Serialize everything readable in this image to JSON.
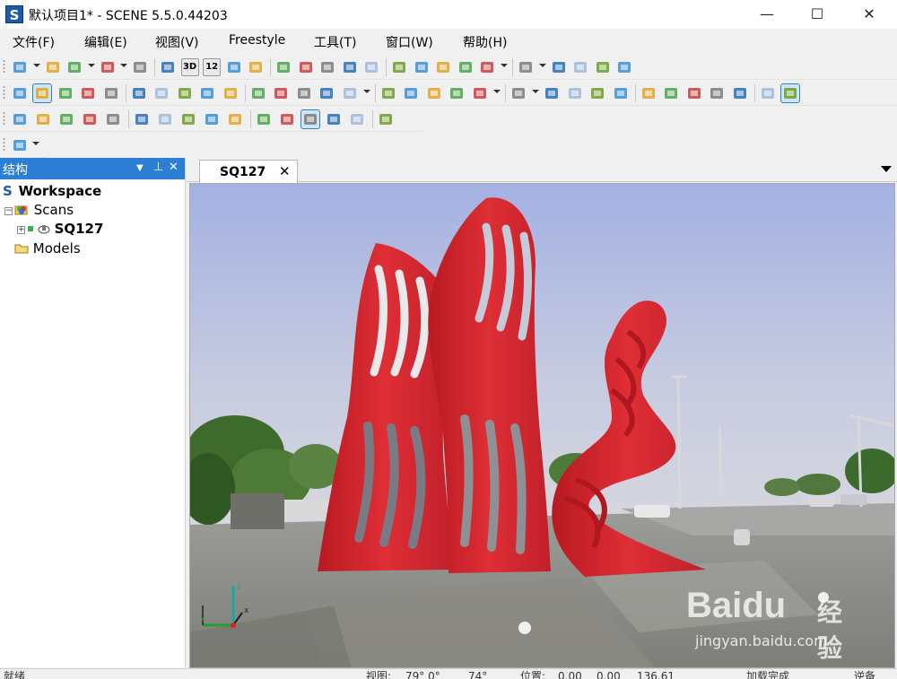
{
  "window": {
    "title": "默认项目1* - SCENE 5.5.0.44203",
    "icon_letter": "S",
    "controls": {
      "minimize": "—",
      "maximize": "☐",
      "close": "✕"
    }
  },
  "menu": {
    "items": [
      "文件(F)",
      "编辑(E)",
      "视图(V)",
      "Freestyle",
      "工具(T)",
      "窗口(W)",
      "帮助(H)"
    ]
  },
  "toolbar": {
    "row1": [
      {
        "icon": "new-project-icon",
        "dropdown": true
      },
      {
        "icon": "open-project-icon"
      },
      {
        "icon": "save-icon",
        "dropdown": true
      },
      {
        "icon": "print-icon",
        "dropdown": true
      },
      {
        "icon": "help-icon"
      },
      {
        "icon": "scan-icon"
      },
      {
        "icon": "view-3d-icon",
        "label": "3D"
      },
      {
        "icon": "view-12-icon",
        "label": "12"
      },
      {
        "icon": "home-view-icon"
      },
      {
        "icon": "image-view-icon"
      },
      {
        "icon": "copy-icon"
      },
      {
        "icon": "refresh-icon"
      },
      {
        "icon": "import-icon"
      },
      {
        "icon": "calendar-icon"
      },
      {
        "icon": "report-icon"
      },
      {
        "icon": "printer-icon"
      },
      {
        "icon": "cloud-add-icon"
      },
      {
        "icon": "cloud-icon"
      },
      {
        "icon": "cloud-remove-icon"
      },
      {
        "icon": "camera-add-icon",
        "dropdown": true
      },
      {
        "icon": "camera-zoom-icon",
        "dropdown": true
      },
      {
        "icon": "globe-target-icon"
      },
      {
        "icon": "measure-icon"
      },
      {
        "icon": "ruler-icon"
      },
      {
        "icon": "line-measure-icon"
      }
    ],
    "row2": [
      {
        "icon": "navigate-icon"
      },
      {
        "icon": "globe-icon",
        "active": true
      },
      {
        "icon": "link-icon"
      },
      {
        "icon": "chain-icon"
      },
      {
        "icon": "arrow-up-icon"
      },
      {
        "icon": "arrow-diag-icon"
      },
      {
        "icon": "arrow-right-icon"
      },
      {
        "icon": "cube-front-icon"
      },
      {
        "icon": "cube-side-icon"
      },
      {
        "icon": "cube-top-icon"
      },
      {
        "icon": "cube-iso-icon"
      },
      {
        "icon": "cube-iso2-icon"
      },
      {
        "icon": "zoom-search-icon"
      },
      {
        "icon": "target-icon"
      },
      {
        "icon": "video-camera-icon",
        "dropdown": true
      },
      {
        "icon": "person-camera-icon"
      },
      {
        "icon": "camera-move-icon"
      },
      {
        "icon": "film-icon"
      },
      {
        "icon": "image-frame-icon"
      },
      {
        "icon": "tripod-icon",
        "dropdown": true
      },
      {
        "icon": "grid-icon",
        "dropdown": true
      },
      {
        "icon": "document-icon"
      },
      {
        "icon": "flag-icon"
      },
      {
        "icon": "flag-blue-icon"
      },
      {
        "icon": "pin-icon"
      },
      {
        "icon": "dots-sparse-icon"
      },
      {
        "icon": "dots-medium-icon"
      },
      {
        "icon": "dots-dense-icon"
      },
      {
        "icon": "dots-cluster-icon"
      },
      {
        "icon": "grid-dark-icon"
      },
      {
        "icon": "grid-light-icon"
      },
      {
        "icon": "pixel-icon",
        "active": true
      }
    ],
    "row3": [
      {
        "icon": "select-box-icon"
      },
      {
        "icon": "select-points-icon"
      },
      {
        "icon": "rotate-select-icon"
      },
      {
        "icon": "select-frame-icon"
      },
      {
        "icon": "select-fill-icon"
      },
      {
        "icon": "select-point-icon"
      },
      {
        "icon": "rect-select-icon"
      },
      {
        "icon": "line-select-icon"
      },
      {
        "icon": "polygon-select-icon"
      },
      {
        "icon": "circle-select-icon"
      },
      {
        "icon": "ellipse-select-icon"
      },
      {
        "icon": "corner-select-icon"
      },
      {
        "icon": "mode-single-icon",
        "active": true
      },
      {
        "icon": "mode-union-icon"
      },
      {
        "icon": "mode-subtract-icon"
      },
      {
        "icon": "mode-intersect-icon"
      }
    ],
    "row4": [
      {
        "icon": "scan-image-icon",
        "dropdown": true
      }
    ]
  },
  "structure_panel": {
    "title": "结构",
    "header_buttons": {
      "dropdown": "▼",
      "pin": "⊥",
      "close": "✕"
    },
    "tree": {
      "workspace": "Workspace",
      "scans": "Scans",
      "scan_item": "SQ127",
      "models": "Models"
    }
  },
  "tabs": {
    "active": "SQ127",
    "close_glyph": "✕"
  },
  "viewport": {
    "axis_labels": {
      "x": "x",
      "y": "y",
      "z": "z"
    },
    "colors": {
      "sky_top": "#a6b3e0",
      "sky_bottom": "#cfd3e1",
      "sculpture_red": "#d2262e",
      "ground": "#8d8d88"
    }
  },
  "statusbar": {
    "ready": "就绪",
    "view_label": "视图:",
    "view_value": "79° 0°",
    "view_extra": "74°",
    "position_label": "位置:",
    "position_x": "0.00",
    "position_y": "0.00",
    "position_z": "136.61",
    "load_status": "加载完成",
    "extra": "逆备"
  },
  "watermark": {
    "brand": "Baidu",
    "brand_cn": "经验",
    "url": "jingyan.baidu.com"
  }
}
